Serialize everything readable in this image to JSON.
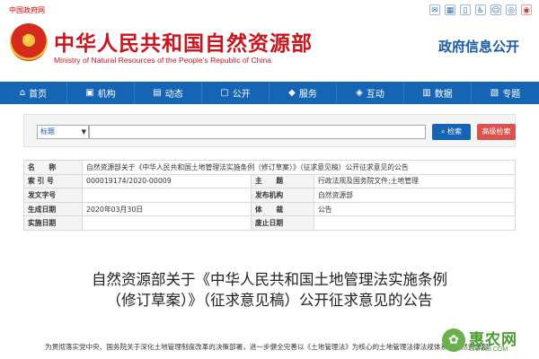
{
  "topbar": {
    "gov_link": "中国政府网",
    "icons": [
      "mail-icon",
      "grid-icon",
      "phone-icon",
      "accessibility-icon",
      "elder-icon",
      "wechat-icon",
      "weibo-icon"
    ]
  },
  "header": {
    "title": "中华人民共和国自然资源部",
    "subtitle": "Ministry of Natural Resources of the People's Republic of China",
    "gov_open": "政府信息公开"
  },
  "nav": {
    "items": [
      {
        "label": "首页",
        "icon": "home-icon"
      },
      {
        "label": "机构",
        "icon": "org-icon"
      },
      {
        "label": "动态",
        "icon": "news-icon"
      },
      {
        "label": "公开",
        "icon": "open-icon"
      },
      {
        "label": "服务",
        "icon": "service-icon"
      },
      {
        "label": "互动",
        "icon": "chat-icon"
      },
      {
        "label": "数据",
        "icon": "data-icon"
      },
      {
        "label": "专题",
        "icon": "topic-icon"
      }
    ]
  },
  "search": {
    "scope": "标题",
    "value": "",
    "search_label": "检索",
    "advanced_label": "高级检索"
  },
  "info": {
    "name_label": "名　　称",
    "name_value": "自然资源部关于《中华人民共和国土地管理法实施条例（修订草案）》（征求意见稿）公开征求意见的公告",
    "index_label": "索 引 号",
    "index_value": "000019174/2020-00009",
    "topic_label": "主　　题",
    "topic_value": "行政法规及国务院文件;土地管理",
    "docno_label": "发文字号",
    "docno_value": "",
    "issuer_label": "发布机构",
    "issuer_value": "自然资源部",
    "date_label": "生成日期",
    "date_value": "2020年03月30日",
    "genre_label": "体　　裁",
    "genre_value": "公告",
    "impl_label": "实施日期",
    "impl_value": "",
    "repeal_label": "废止日期",
    "repeal_value": ""
  },
  "article": {
    "title": "自然资源部关于《中华人民共和国土地管理法实施条例（修订草案）》（征求意见稿）公开征求意见的公告",
    "body": "为贯彻落实党中央、国务院关于深化土地管理制度改革的决策部署，进一步健全完善以《土地管理法》为核心的土地管理法律法规体系，自然资源部"
  },
  "watermark": {
    "text": "惠农网",
    "url": "CNHNB.COM"
  },
  "colors": {
    "brand_red": "#c8161d",
    "nav_blue": "#1565b4",
    "search_button": "#1565b4",
    "advanced_button": "#d9534f",
    "watermark_green": "#4a9d2f"
  }
}
